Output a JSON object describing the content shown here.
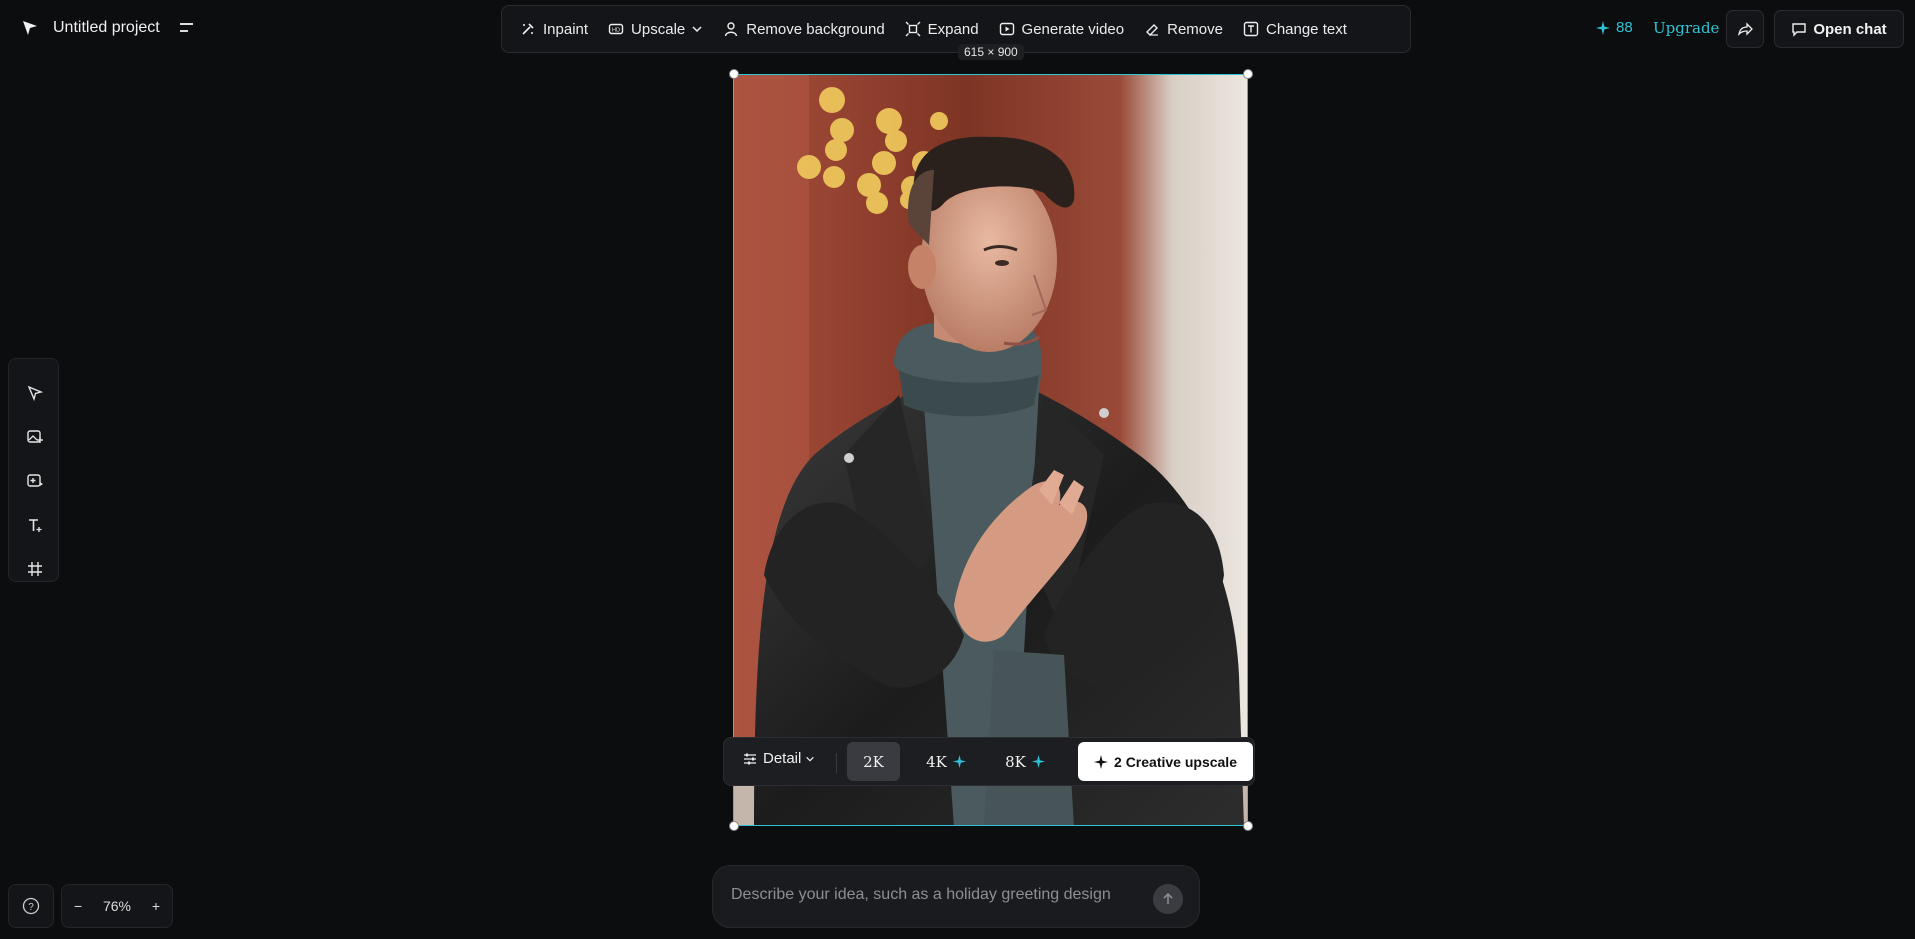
{
  "header": {
    "project_title": "Untitled project",
    "credits": "88",
    "upgrade_label": "Upgrade",
    "open_chat_label": "Open chat"
  },
  "toolbar": {
    "items": [
      {
        "label": "Inpaint",
        "icon": "inpaint-icon"
      },
      {
        "label": "Upscale",
        "icon": "upscale-hd-icon"
      },
      {
        "label": "Remove background",
        "icon": "remove-background-icon"
      },
      {
        "label": "Expand",
        "icon": "expand-icon"
      },
      {
        "label": "Generate video",
        "icon": "video-icon"
      },
      {
        "label": "Remove",
        "icon": "eraser-icon"
      },
      {
        "label": "Change text",
        "icon": "text-box-icon"
      }
    ]
  },
  "canvas": {
    "dimensions_label": "615 × 900",
    "image_description": "portrait-photo"
  },
  "left_tools": [
    "select-tool",
    "add-image-tool",
    "generate-image-tool",
    "text-tool",
    "frame-tool"
  ],
  "upscale_panel": {
    "mode_label": "Detail",
    "resolutions": [
      {
        "label": "2K",
        "selected": true,
        "premium": false
      },
      {
        "label": "4K",
        "selected": false,
        "premium": true
      },
      {
        "label": "8K",
        "selected": false,
        "premium": true
      }
    ],
    "creative_label": "2 Creative upscale"
  },
  "zoom": {
    "level": "76%",
    "minus": "−",
    "plus": "+"
  },
  "prompt": {
    "placeholder": "Describe your idea, such as a holiday greeting design"
  },
  "colors": {
    "accent": "#2ec4d6",
    "background": "#0c0d0f",
    "panel": "#141518"
  }
}
